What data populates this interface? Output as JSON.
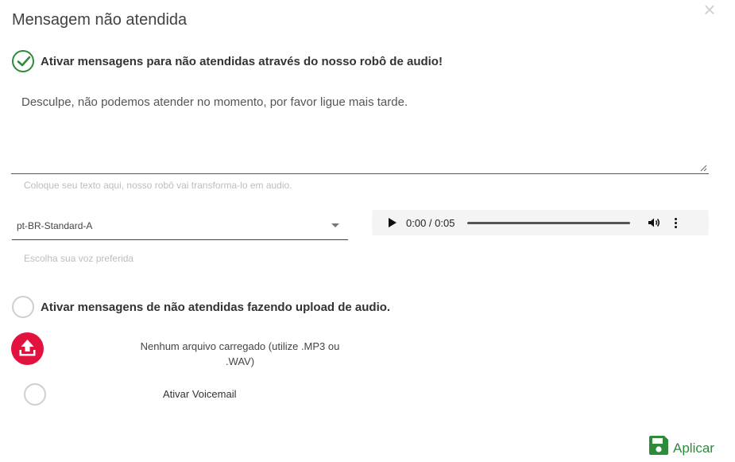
{
  "dialog": {
    "title": "Mensagem não atendida",
    "close_symbol": "×"
  },
  "tts_option": {
    "label": "Ativar mensagens para não atendidas através do nosso robô de audio!",
    "checked": true,
    "icon": "check-icon"
  },
  "message": {
    "text": "Desculpe, não podemos atender no momento, por favor ligue mais tarde.",
    "hint": "Coloque seu texto aqui, nosso robô vai transforma-lo em audio."
  },
  "voice": {
    "selected": "pt-BR-Standard-A",
    "hint": "Escolha sua voz preferida"
  },
  "audio_player": {
    "time": "0:00 / 0:05",
    "progress": 0
  },
  "upload_option": {
    "label": "Ativar mensagens de não atendidas fazendo upload de audio.",
    "checked": false
  },
  "upload": {
    "status": "Nenhum arquivo carregado (utilize .MP3 ou .WAV)",
    "icon": "upload-icon",
    "color": "#e2123f"
  },
  "voicemail": {
    "label": "Ativar Voicemail",
    "checked": false
  },
  "actions": {
    "apply_label": "Aplicar",
    "apply_icon": "save-icon",
    "color": "#2e8b3a"
  }
}
